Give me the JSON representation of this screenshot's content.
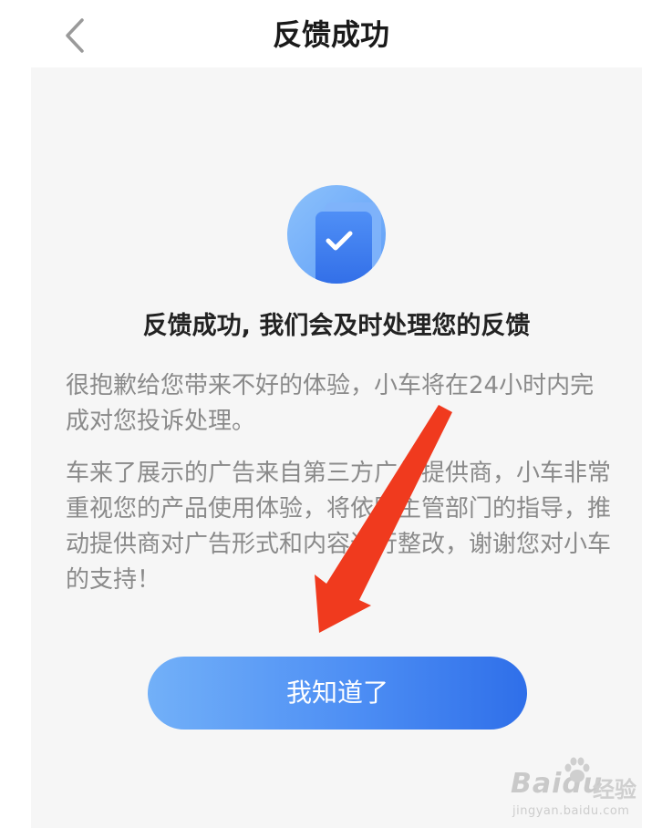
{
  "header": {
    "title": "反馈成功",
    "back_icon": "chevron-left-icon"
  },
  "content": {
    "icon": "document-check-icon",
    "headline": "反馈成功, 我们会及时处理您的反馈",
    "paragraph1": "很抱歉给您带来不好的体验，小车将在24小时内完成对您投诉处理。",
    "paragraph2": "车来了展示的广告来自第三方广告提供商，小车非常重视您的产品使用体验，将依照主管部门的指导，推动提供商对广告形式和内容进行整改，谢谢您对小车的支持！",
    "button_label": "我知道了"
  },
  "watermark": {
    "logo": "Baidu",
    "suffix": "经验",
    "url": "jingyan.baidu.com"
  },
  "colors": {
    "accent": "#3a7ef0",
    "annotation_arrow": "#f03a1e",
    "panel_bg": "#f6f6f6",
    "body_text": "#8a8a8a"
  }
}
